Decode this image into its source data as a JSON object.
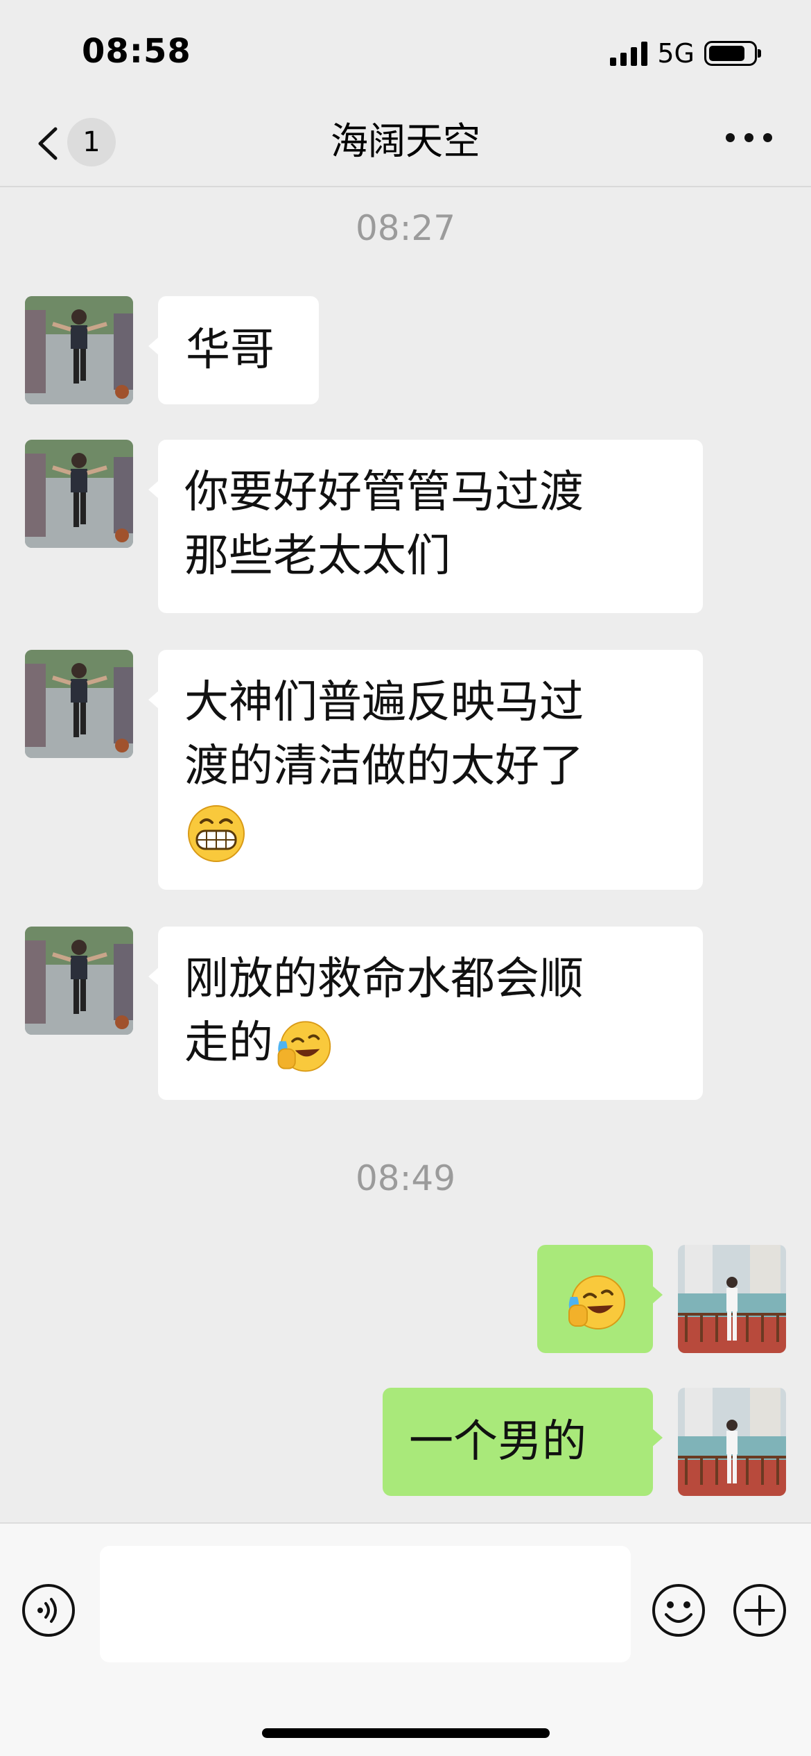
{
  "status_bar": {
    "time": "08:58",
    "network": "5G",
    "battery_level": 0.82
  },
  "nav": {
    "back_badge": "1",
    "title": "海阔天空"
  },
  "messages": [
    {
      "type": "timestamp",
      "text": "08:27"
    },
    {
      "type": "incoming",
      "text": "华哥"
    },
    {
      "type": "incoming",
      "line1": "你要好好管管马过渡",
      "line2": "那些老太太们"
    },
    {
      "type": "incoming",
      "line1": "大神们普遍反映马过",
      "line2": "渡的清洁做的太好了",
      "emoji": "grinning-face-emoji"
    },
    {
      "type": "incoming",
      "line1": "刚放的救命水都会顺",
      "line2": "走的",
      "emoji": "crying-laughing-emoji"
    },
    {
      "type": "timestamp",
      "text": "08:49"
    },
    {
      "type": "outgoing",
      "emoji": "crying-laughing-emoji"
    },
    {
      "type": "outgoing",
      "text": "一个男的"
    }
  ],
  "input_bar": {
    "placeholder": ""
  },
  "colors": {
    "background": "#ededed",
    "incoming_bubble": "#ffffff",
    "outgoing_bubble": "#a9e97a",
    "timestamp": "#9b9b9b"
  }
}
